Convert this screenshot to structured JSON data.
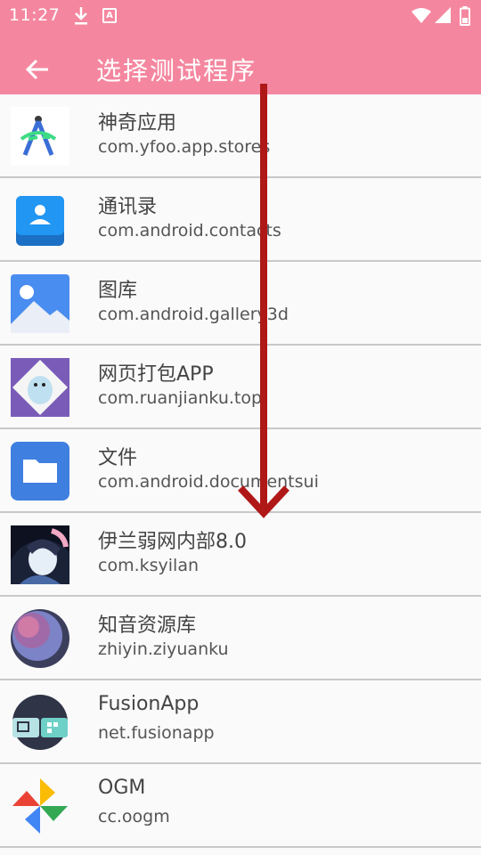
{
  "status_bar": {
    "time": "11:27"
  },
  "app_bar": {
    "title": "选择测试程序"
  },
  "apps": [
    {
      "name": "神奇应用",
      "package": "com.yfoo.app.stores",
      "icon": "android-studio-icon"
    },
    {
      "name": "通讯录",
      "package": "com.android.contacts",
      "icon": "contacts-icon"
    },
    {
      "name": "图库",
      "package": "com.android.gallery3d",
      "icon": "gallery-icon"
    },
    {
      "name": "网页打包APP",
      "package": "com.ruanjianku.top",
      "icon": "moomin-icon"
    },
    {
      "name": "文件",
      "package": "com.android.documentsui",
      "icon": "folder-icon"
    },
    {
      "name": "伊兰弱网内部8.0",
      "package": "com.ksyilan",
      "icon": "anime-avatar-icon"
    },
    {
      "name": "知音资源库",
      "package": "zhiyin.ziyuanku",
      "icon": "sphere-icon"
    },
    {
      "name": "FusionApp",
      "package": "net.fusionapp",
      "icon": "fusionapp-icon"
    },
    {
      "name": "OGM",
      "package": "cc.oogm",
      "icon": "pinwheel-icon"
    }
  ],
  "colors": {
    "accent": "#f4879f",
    "arrow": "#b01818"
  }
}
